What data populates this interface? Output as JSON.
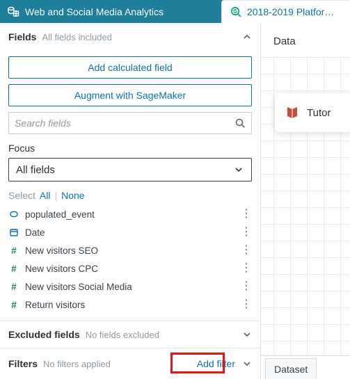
{
  "topbar": {
    "title": "Web and Social Media Analytics",
    "platform_label": "2018-2019 Platfor…"
  },
  "fields_section": {
    "title": "Fields",
    "subtitle": "All fields included"
  },
  "buttons": {
    "add_calculated": "Add calculated field",
    "augment": "Augment with SageMaker"
  },
  "search": {
    "placeholder": "Search fields"
  },
  "focus": {
    "label": "Focus",
    "value": "All fields"
  },
  "select_row": {
    "label": "Select",
    "all": "All",
    "none": "None"
  },
  "fields": [
    {
      "name": "populated_event",
      "icon": "set",
      "color": "blue"
    },
    {
      "name": "Date",
      "icon": "date",
      "color": "blue"
    },
    {
      "name": "New visitors SEO",
      "icon": "hash",
      "color": "green"
    },
    {
      "name": "New visitors CPC",
      "icon": "hash",
      "color": "green"
    },
    {
      "name": "New visitors Social Media",
      "icon": "hash",
      "color": "green"
    },
    {
      "name": "Return visitors",
      "icon": "hash",
      "color": "green"
    }
  ],
  "excluded": {
    "title": "Excluded fields",
    "subtitle": "No fields excluded"
  },
  "filters": {
    "title": "Filters",
    "subtitle": "No filters applied",
    "add_label": "Add filter"
  },
  "right": {
    "header": "Data",
    "tutor": "Tutor",
    "tab": "Dataset"
  },
  "colors": {
    "accent": "#0e72b2",
    "teal": "#1f7e9a"
  }
}
